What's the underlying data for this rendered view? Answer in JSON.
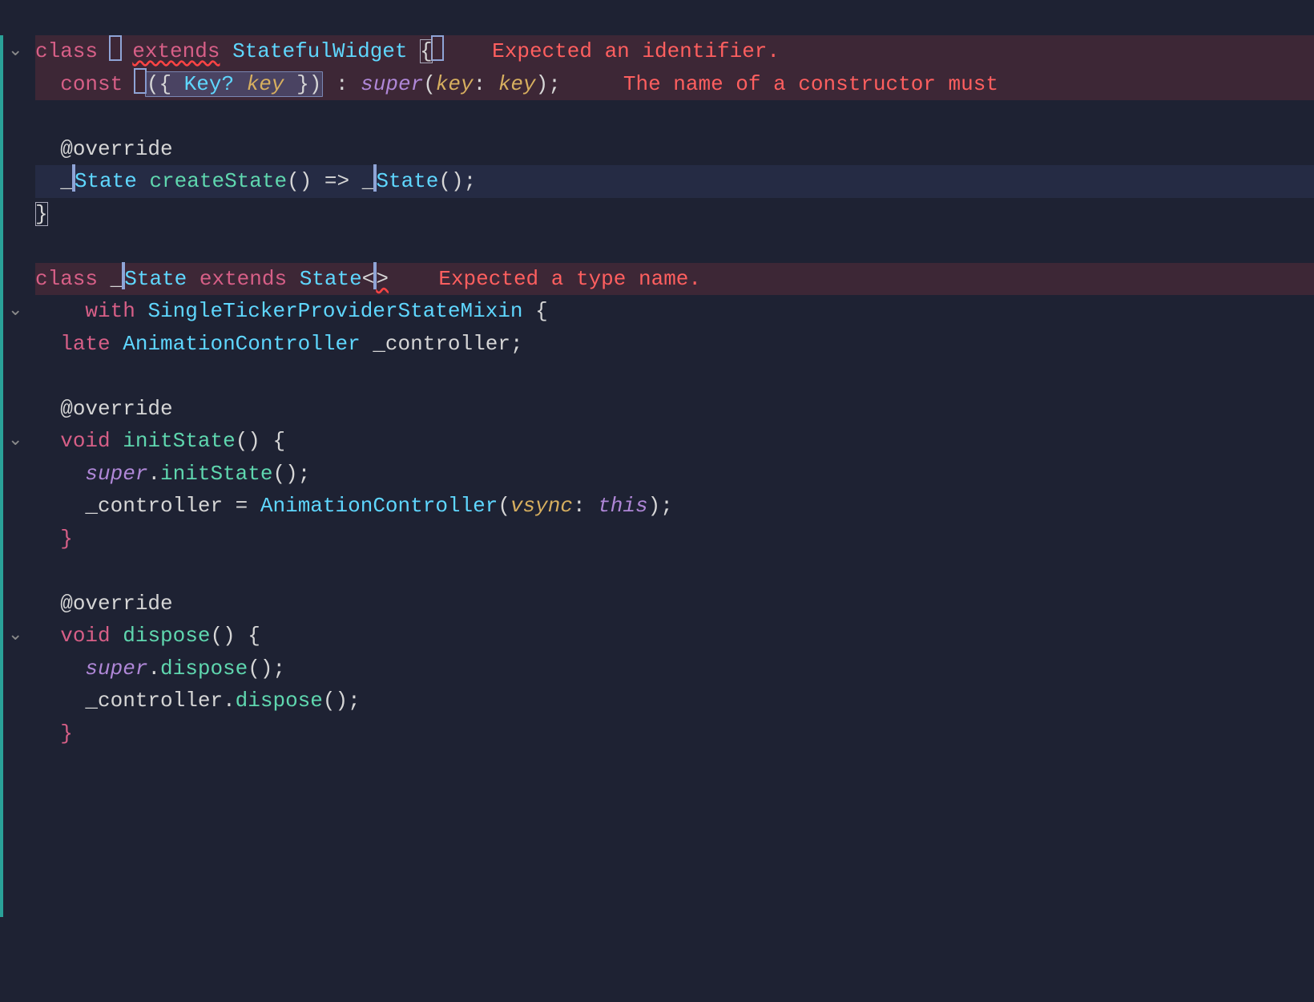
{
  "errors": {
    "e1": "Expected an identifier.",
    "e2": "The name of a constructor must ",
    "e3": "Expected a type name."
  },
  "tokens": {
    "kw_class": "class",
    "kw_extends": "extends",
    "kw_const": "const",
    "kw_with": "with",
    "kw_late": "late",
    "kw_void": "void",
    "kw_super": "super",
    "kw_this": "this",
    "t_StatefulWidget": "StatefulWidget",
    "t_Key": "Key?",
    "t_State": "State",
    "t_SingleTicker": "SingleTickerProviderStateMixin",
    "t_AnimationController": "AnimationController",
    "id_key": "key",
    "id_controller": "_controller",
    "id_underscore": "_",
    "id_statepart": "State",
    "anno_override": "@override",
    "fn_createState": "createState",
    "fn_initState": "initState",
    "fn_dispose": "dispose",
    "p_key": "key",
    "p_vsync": "vsync",
    "dot": ".",
    "comma": ",",
    "colon": ":",
    "semicolon": ";",
    "eq": "=",
    "arrow": "=>",
    "lt": "<",
    "gt": ">",
    "lparen": "(",
    "rparen": ")",
    "lbrace": "{",
    "rbrace": "}"
  }
}
